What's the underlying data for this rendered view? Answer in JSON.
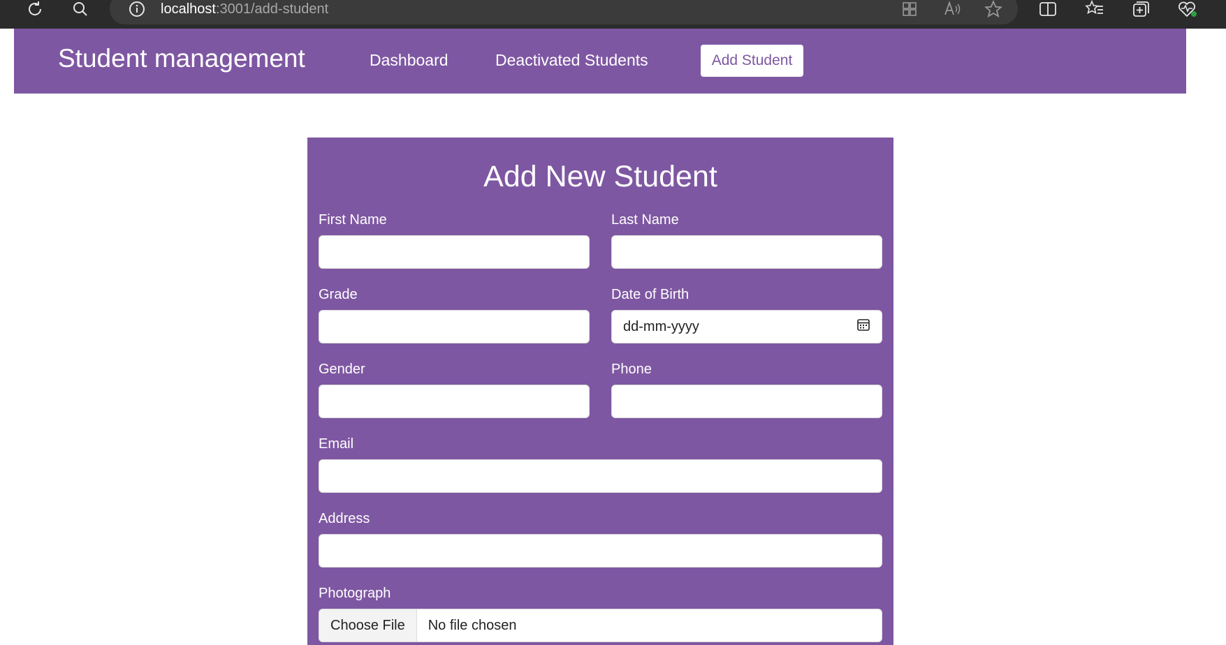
{
  "browser": {
    "url_host": "localhost",
    "url_path": ":3001/add-student",
    "toolbar_icons": [
      "refresh-icon",
      "search-icon",
      "site-info-icon",
      "apps-icon",
      "read-aloud-icon",
      "favorite-star-icon",
      "split-screen-icon",
      "favorites-list-icon",
      "collections-icon",
      "browser-essentials-icon"
    ]
  },
  "navbar": {
    "brand": "Student management",
    "links": [
      {
        "label": "Dashboard"
      },
      {
        "label": "Deactivated Students"
      },
      {
        "label": "Add Student",
        "active": true
      }
    ],
    "color": "#7e57a2"
  },
  "form": {
    "title": "Add New Student",
    "fields": {
      "first_name": {
        "label": "First Name",
        "value": ""
      },
      "last_name": {
        "label": "Last Name",
        "value": ""
      },
      "grade": {
        "label": "Grade",
        "value": ""
      },
      "dob": {
        "label": "Date of Birth",
        "placeholder": "dd-mm-yyyy"
      },
      "gender": {
        "label": "Gender",
        "value": ""
      },
      "phone": {
        "label": "Phone",
        "value": ""
      },
      "email": {
        "label": "Email",
        "value": ""
      },
      "address": {
        "label": "Address",
        "value": ""
      },
      "photograph": {
        "label": "Photograph",
        "button": "Choose File",
        "status": "No file chosen"
      }
    }
  }
}
